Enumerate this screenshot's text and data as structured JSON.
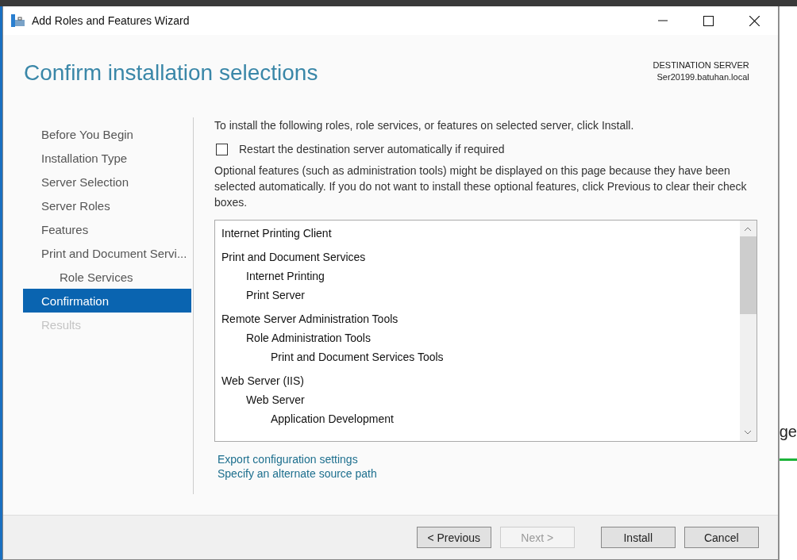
{
  "window": {
    "title": "Add Roles and Features Wizard"
  },
  "header": {
    "title": "Confirm installation selections",
    "destination_label": "DESTINATION SERVER",
    "destination_server": "Ser20199.batuhan.local"
  },
  "sidebar": {
    "items": [
      {
        "label": "Before You Begin",
        "selected": false,
        "disabled": false
      },
      {
        "label": "Installation Type",
        "selected": false,
        "disabled": false
      },
      {
        "label": "Server Selection",
        "selected": false,
        "disabled": false
      },
      {
        "label": "Server Roles",
        "selected": false,
        "disabled": false
      },
      {
        "label": "Features",
        "selected": false,
        "disabled": false
      },
      {
        "label": "Print and Document Servi...",
        "selected": false,
        "disabled": false,
        "children": [
          {
            "label": "Role Services",
            "selected": false,
            "disabled": false
          }
        ]
      },
      {
        "label": "Confirmation",
        "selected": true,
        "disabled": false
      },
      {
        "label": "Results",
        "selected": false,
        "disabled": true
      }
    ]
  },
  "content": {
    "instruction": "To install the following roles, role services, or features on selected server, click Install.",
    "restart_checkbox": {
      "label": "Restart the destination server automatically if required",
      "checked": false
    },
    "note": "Optional features (such as administration tools) might be displayed on this page because they have been selected automatically. If you do not want to install these optional features, click Previous to clear their check boxes.",
    "selections": [
      {
        "label": "Internet Printing Client"
      },
      {
        "label": "Print and Document Services",
        "children": [
          {
            "label": "Internet Printing"
          },
          {
            "label": "Print Server"
          }
        ]
      },
      {
        "label": "Remote Server Administration Tools",
        "children": [
          {
            "label": "Role Administration Tools",
            "children": [
              {
                "label": "Print and Document Services Tools"
              }
            ]
          }
        ]
      },
      {
        "label": "Web Server (IIS)",
        "children": [
          {
            "label": "Web Server",
            "children": [
              {
                "label": "Application Development"
              }
            ]
          }
        ]
      }
    ],
    "links": [
      "Export configuration settings",
      "Specify an alternate source path"
    ]
  },
  "buttons": [
    {
      "label": "< Previous",
      "disabled": false
    },
    {
      "label": "Next >",
      "disabled": true
    },
    {
      "label": "Install",
      "disabled": false
    },
    {
      "label": "Cancel",
      "disabled": false
    }
  ],
  "background_fragment": "ge"
}
